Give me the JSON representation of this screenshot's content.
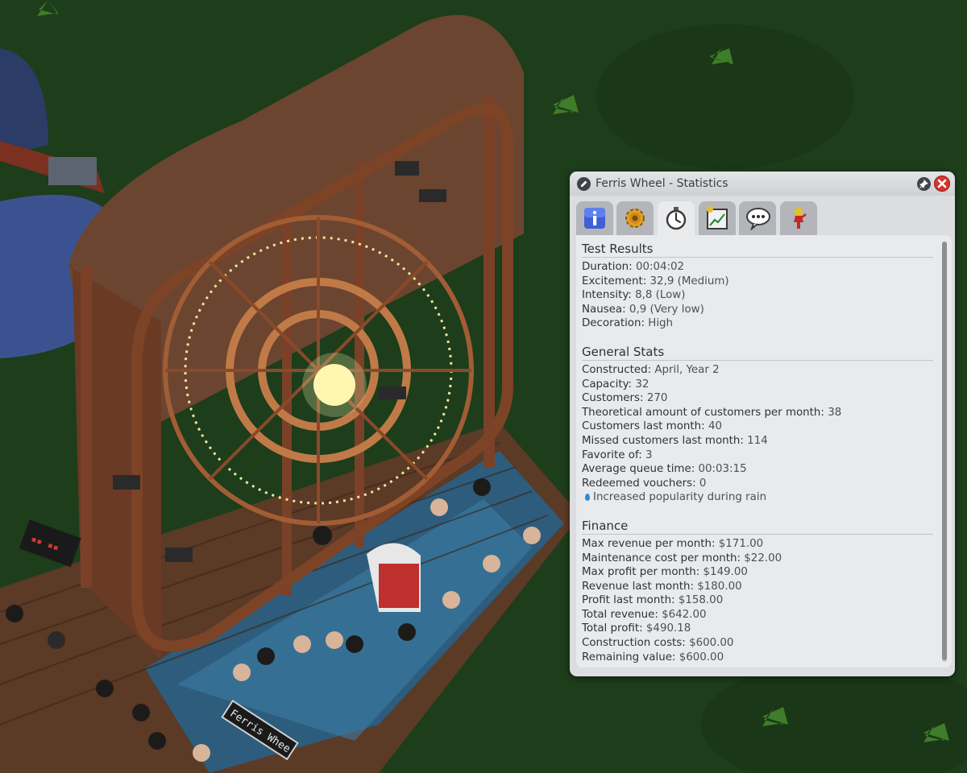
{
  "window": {
    "title": "Ferris Wheel - Statistics",
    "tabs": [
      {
        "icon": "info-icon",
        "active": false
      },
      {
        "icon": "gear-icon",
        "active": false
      },
      {
        "icon": "stopwatch-icon",
        "active": true
      },
      {
        "icon": "graph-icon",
        "active": false
      },
      {
        "icon": "speech-bubble-icon",
        "active": false
      },
      {
        "icon": "mechanic-icon",
        "active": false
      }
    ]
  },
  "scene": {
    "sign_text": "Ferris Whee"
  },
  "test_results": {
    "title": "Test Results",
    "rows": [
      {
        "label": "Duration:",
        "value": "00:04:02"
      },
      {
        "label": "Excitement:",
        "value": "32,9 (Medium)"
      },
      {
        "label": "Intensity:",
        "value": "8,8 (Low)"
      },
      {
        "label": "Nausea:",
        "value": "0,9 (Very low)"
      },
      {
        "label": "Decoration:",
        "value": "High"
      }
    ]
  },
  "general_stats": {
    "title": "General Stats",
    "rows": [
      {
        "label": "Constructed:",
        "value": "April, Year 2"
      },
      {
        "label": "Capacity:",
        "value": "32"
      },
      {
        "label": "Customers:",
        "value": "270"
      },
      {
        "label": "Theoretical amount of customers per month:",
        "value": "38"
      },
      {
        "label": "Customers last month:",
        "value": "40"
      },
      {
        "label": "Missed customers last month:",
        "value": "114"
      },
      {
        "label": "Favorite of:",
        "value": "3"
      },
      {
        "label": "Average queue time:",
        "value": "00:03:15"
      },
      {
        "label": "Redeemed vouchers:",
        "value": "0"
      }
    ],
    "note": "Increased popularity during rain"
  },
  "finance": {
    "title": "Finance",
    "rows": [
      {
        "label": "Max revenue per month:",
        "value": "$171.00"
      },
      {
        "label": "Maintenance cost per month:",
        "value": "$22.00"
      },
      {
        "label": "Max profit per month:",
        "value": "$149.00"
      },
      {
        "label": "Revenue last month:",
        "value": "$180.00"
      },
      {
        "label": "Profit last month:",
        "value": "$158.00"
      },
      {
        "label": "Total revenue:",
        "value": "$642.00"
      },
      {
        "label": "Total profit:",
        "value": "$490.18"
      },
      {
        "label": "Construction costs:",
        "value": "$600.00"
      },
      {
        "label": "Remaining value:",
        "value": "$600.00"
      }
    ]
  }
}
